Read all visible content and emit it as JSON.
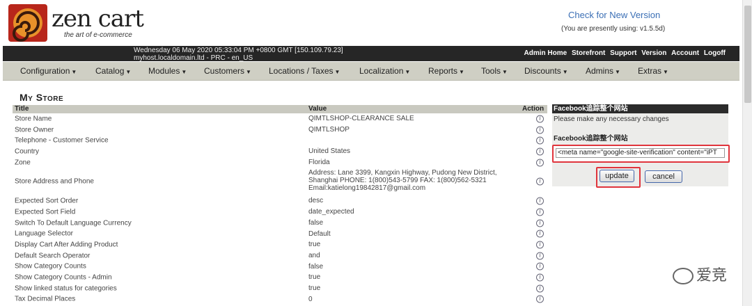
{
  "logo": {
    "brand": "zen cart",
    "tagline": "the art of e-commerce"
  },
  "version": {
    "link": "Check for New Version",
    "info": "(You are presently using: v1.5.5d)"
  },
  "topbar": {
    "datetime": "Wednesday 06 May 2020 05:33:04 PM +0800 GMT [150.109.79.23]",
    "host": "myhost.localdomain.ltd - PRC - en_US",
    "links": [
      "Admin Home",
      "Storefront",
      "Support",
      "Version",
      "Account",
      "Logoff"
    ]
  },
  "menu": [
    "Configuration",
    "Catalog",
    "Modules",
    "Customers",
    "Locations / Taxes",
    "Localization",
    "Reports",
    "Tools",
    "Discounts",
    "Admins",
    "Extras"
  ],
  "page_title": "My Store",
  "table": {
    "headers": {
      "title": "Title",
      "value": "Value",
      "action": "Action"
    },
    "rows": [
      {
        "title": "Store Name",
        "value": "QIMTLSHOP-CLEARANCE SALE"
      },
      {
        "title": "Store Owner",
        "value": "QIMTLSHOP"
      },
      {
        "title": "Telephone - Customer Service",
        "value": ""
      },
      {
        "title": "Country",
        "value": "United States"
      },
      {
        "title": "Zone",
        "value": "Florida"
      },
      {
        "title": "Store Address and Phone",
        "value": "Address: Lane 3399, Kangxin Highway, Pudong New District, Shanghai PHONE: 1(800)543-5799 FAX: 1(800)562-5321 Email:katielong19842817@gmail.com"
      },
      {
        "title": "Expected Sort Order",
        "value": "desc"
      },
      {
        "title": "Expected Sort Field",
        "value": "date_expected"
      },
      {
        "title": "Switch To Default Language Currency",
        "value": "false"
      },
      {
        "title": "Language Selector",
        "value": "Default"
      },
      {
        "title": "Display Cart After Adding Product",
        "value": "true"
      },
      {
        "title": "Default Search Operator",
        "value": "and"
      },
      {
        "title": "Show Category Counts",
        "value": "false"
      },
      {
        "title": "Show Category Counts - Admin",
        "value": "true"
      },
      {
        "title": "Show linked status for categories",
        "value": "true"
      },
      {
        "title": "Tax Decimal Places",
        "value": "0"
      }
    ]
  },
  "panel": {
    "header": "Facebook追踪整个网站",
    "note": "Please make any necessary changes",
    "label": "Facebook追踪整个网站",
    "input_value": "<meta name=\"google-site-verification\" content=\"iPT",
    "update": "update",
    "cancel": "cancel"
  },
  "watermark": "爱竞"
}
